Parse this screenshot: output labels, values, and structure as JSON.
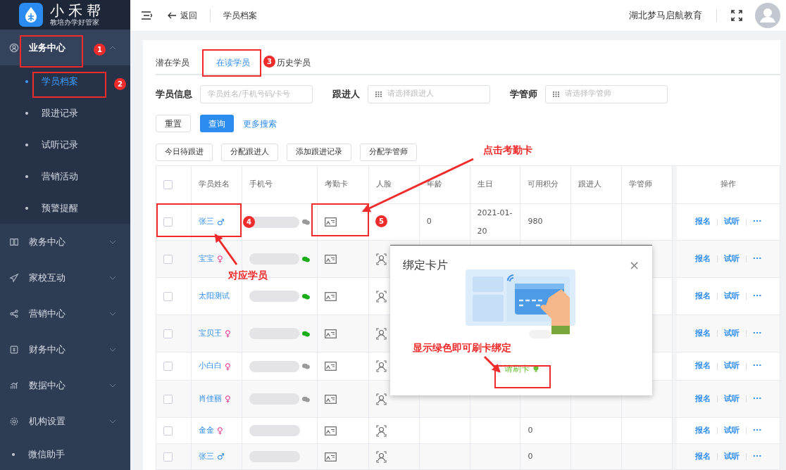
{
  "logo": {
    "name": "小禾帮",
    "slogan": "教培办学好管家"
  },
  "sidebar": {
    "items": [
      {
        "kind": "group",
        "label": "业务中心",
        "expanded": true,
        "children": [
          {
            "label": "学员档案",
            "selected": true
          },
          {
            "label": "跟进记录",
            "selected": false
          },
          {
            "label": "试听记录",
            "selected": false
          },
          {
            "label": "营销活动",
            "selected": false
          },
          {
            "label": "预警提醒",
            "selected": false
          }
        ]
      },
      {
        "kind": "group",
        "label": "教务中心",
        "expanded": false
      },
      {
        "kind": "group",
        "label": "家校互动",
        "expanded": false
      },
      {
        "kind": "group",
        "label": "营销中心",
        "expanded": false
      },
      {
        "kind": "group",
        "label": "财务中心",
        "expanded": false
      },
      {
        "kind": "group",
        "label": "数据中心",
        "expanded": false
      },
      {
        "kind": "group",
        "label": "机构设置",
        "expanded": false
      },
      {
        "kind": "link",
        "label": "微信助手"
      }
    ]
  },
  "header": {
    "back": "返回",
    "page": "学员档案",
    "org": "湖北梦马启航教育"
  },
  "tabs": [
    {
      "label": "潜在学员",
      "selected": false
    },
    {
      "label": "在读学员",
      "selected": true
    },
    {
      "label": "历史学员",
      "selected": false
    }
  ],
  "filters": [
    {
      "kind": "input",
      "label": "学员信息",
      "placeholder": "学员姓名/手机号码/卡号"
    },
    {
      "kind": "select",
      "label": "跟进人",
      "placeholder": "请选择跟进人"
    },
    {
      "kind": "select",
      "label": "学管师",
      "placeholder": "请选择学管师"
    }
  ],
  "query_buttons": [
    {
      "kind": "plain",
      "label": "重置"
    },
    {
      "kind": "primary",
      "label": "查询"
    },
    {
      "kind": "link",
      "label": "更多搜索"
    }
  ],
  "action_buttons": [
    "今日待跟进",
    "分配跟进人",
    "添加跟进记录",
    "分配学管师"
  ],
  "table": {
    "select_all_checked": false,
    "columns": [
      "学员姓名",
      "手机号",
      "考勤卡",
      "人脸",
      "年龄",
      "生日",
      "可用积分",
      "跟进人",
      "学管师",
      "操作"
    ],
    "rows": [
      {
        "checked": false,
        "name": "张三",
        "gender": {
          "symbol": "♂",
          "color": "#2d8cf0"
        },
        "wechat_bound": false,
        "age": "0",
        "birthday": "2021-01-20",
        "points": "980",
        "actions": [
          "报名",
          "试听",
          "···"
        ]
      },
      {
        "checked": false,
        "name": "宝宝",
        "gender": {
          "symbol": "♀",
          "color": "#e8348c"
        },
        "wechat_bound": true,
        "actions": [
          "报名",
          "试听",
          "···"
        ]
      },
      {
        "checked": false,
        "name": "太阳测试",
        "wechat_bound": true,
        "actions": [
          "报名",
          "试听",
          "···"
        ]
      },
      {
        "checked": false,
        "name": "宝贝王",
        "gender": {
          "symbol": "♀",
          "color": "#e8348c"
        },
        "wechat_bound": true,
        "actions": [
          "报名",
          "试听",
          "···"
        ]
      },
      {
        "checked": false,
        "name": "小白白",
        "gender": {
          "symbol": "♀",
          "color": "#e8348c"
        },
        "wechat_bound": false,
        "actions": [
          "报名",
          "试听",
          "···"
        ]
      },
      {
        "checked": false,
        "name": "肖佳丽",
        "gender": {
          "symbol": "♀",
          "color": "#e8348c"
        },
        "wechat_bound": false,
        "actions": [
          "报名",
          "试听",
          "···"
        ]
      },
      {
        "checked": false,
        "name": "金金",
        "gender": {
          "symbol": "♀",
          "color": "#e8348c"
        },
        "points": "0",
        "actions": [
          "报名",
          "试听",
          "···"
        ]
      },
      {
        "checked": false,
        "name": "张三",
        "gender": {
          "symbol": "♂",
          "color": "#2d8cf0"
        },
        "points": "0",
        "actions": [
          "报名",
          "试听",
          "···"
        ]
      }
    ]
  },
  "dialog": {
    "title": "绑定卡片",
    "close": "×",
    "status": "请刷卡",
    "ready": true
  },
  "annotations": {
    "badges": [
      "1",
      "2",
      "3",
      "4",
      "5"
    ],
    "notes": [
      "点击考勤卡",
      "对应学员",
      "显示绿色即可刷卡绑定"
    ]
  }
}
